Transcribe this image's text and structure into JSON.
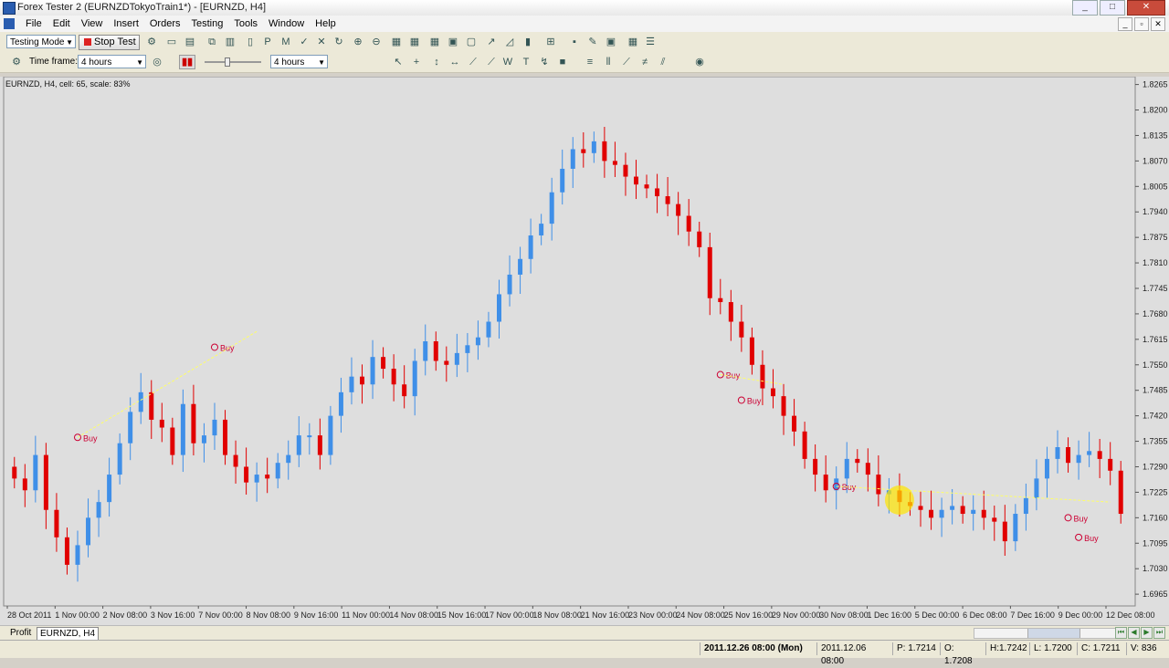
{
  "window": {
    "title": "Forex Tester 2  (EURNZDTokyoTrain1*) - [EURNZD, H4]",
    "minimize": "_",
    "maximize": "□",
    "close": "✕"
  },
  "menu": {
    "items": [
      "File",
      "Edit",
      "View",
      "Insert",
      "Orders",
      "Testing",
      "Tools",
      "Window",
      "Help"
    ],
    "mdi": [
      "_",
      "▫",
      "✕"
    ]
  },
  "toolbar1": {
    "mode_select": "Testing Mode",
    "stop_test_label": "Stop Test",
    "icons": [
      "settings-icon",
      "folder-icon",
      "open-icon",
      "copy-icon",
      "bars-icon",
      "new-doc-icon",
      "p-icon",
      "m-icon",
      "check-icon",
      "x-icon",
      "refresh-icon",
      "zoom-in-icon",
      "zoom-out-icon",
      "grid1-icon",
      "grid2-icon",
      "grid3-icon",
      "window-icon",
      "window2-icon",
      "line-chart-icon",
      "area-chart-icon",
      "candle-chart-icon",
      "plus-indicator-icon",
      "box-icon",
      "brush-icon",
      "camera-icon",
      "calc-icon",
      "list-icon"
    ]
  },
  "toolbar2": {
    "timeframe_label": "Time frame:",
    "timeframe_value": "4 hours",
    "timeframe2_value": "4 hours",
    "slider_pct": 0.4,
    "pause_glyph": "▮▮",
    "icons": [
      "cursor-icon",
      "crosshair-icon",
      "vline-icon",
      "hline-icon",
      "trendline-icon",
      "ray-icon",
      "wave-icon",
      "text-icon",
      "arrow-icon",
      "color-icon",
      "channel-icon",
      "fib-icon",
      "fan-icon",
      "gann-icon",
      "pitchfork-icon",
      "target-icon"
    ]
  },
  "chart": {
    "info": "EURNZD, H4, cell: 65, scale: 83%",
    "colors": {
      "bull": "#3f8fe8",
      "bear": "#e10000",
      "trade_line": "#ffff66",
      "marker": "#cc0033",
      "background": "#dedede"
    },
    "buy_label": "Buy"
  },
  "chart_data": {
    "type": "candlestick",
    "symbol": "EURNZD",
    "timeframe": "H4",
    "ylim": [
      1.6935,
      1.8285
    ],
    "yticks": [
      "1.8265",
      "1.8200",
      "1.8135",
      "1.8070",
      "1.8005",
      "1.7940",
      "1.7875",
      "1.7810",
      "1.7745",
      "1.7680",
      "1.7615",
      "1.7550",
      "1.7485",
      "1.7420",
      "1.7355",
      "1.7290",
      "1.7225",
      "1.7160",
      "1.7095",
      "1.7030",
      "1.6965"
    ],
    "xticks": [
      "28 Oct 2011",
      "1 Nov 00:00",
      "2 Nov 08:00",
      "3 Nov 16:00",
      "7 Nov 00:00",
      "8 Nov 08:00",
      "9 Nov 16:00",
      "11 Nov 00:00",
      "14 Nov 08:00",
      "15 Nov 16:00",
      "17 Nov 00:00",
      "18 Nov 08:00",
      "21 Nov 16:00",
      "23 Nov 00:00",
      "24 Nov 08:00",
      "25 Nov 16:00",
      "29 Nov 00:00",
      "30 Nov 08:00",
      "1 Dec 16:00",
      "5 Dec 00:00",
      "6 Dec 08:00",
      "7 Dec 16:00",
      "9 Dec 00:00",
      "12 Dec 08:00"
    ],
    "approx_closes": [
      1.726,
      1.723,
      1.732,
      1.718,
      1.711,
      1.704,
      1.709,
      1.716,
      1.72,
      1.727,
      1.735,
      1.743,
      1.748,
      1.741,
      1.739,
      1.732,
      1.745,
      1.735,
      1.737,
      1.741,
      1.732,
      1.729,
      1.725,
      1.727,
      1.726,
      1.73,
      1.732,
      1.737,
      1.737,
      1.732,
      1.742,
      1.748,
      1.752,
      1.75,
      1.757,
      1.754,
      1.75,
      1.747,
      1.756,
      1.761,
      1.756,
      1.755,
      1.758,
      1.76,
      1.762,
      1.766,
      1.773,
      1.778,
      1.782,
      1.788,
      1.791,
      1.799,
      1.805,
      1.81,
      1.809,
      1.812,
      1.807,
      1.806,
      1.803,
      1.801,
      1.8,
      1.798,
      1.796,
      1.793,
      1.789,
      1.785,
      1.772,
      1.771,
      1.766,
      1.762,
      1.755,
      1.749,
      1.747,
      1.742,
      1.738,
      1.731,
      1.727,
      1.723,
      1.726,
      1.731,
      1.73,
      1.727,
      1.722,
      1.723,
      1.72,
      1.719,
      1.718,
      1.716,
      1.718,
      1.719,
      1.717,
      1.718,
      1.716,
      1.715,
      1.71,
      1.717,
      1.721,
      1.726,
      1.731,
      1.734,
      1.73,
      1.732,
      1.733,
      1.731,
      1.728,
      1.717
    ],
    "trades": [
      {
        "label": "Buy",
        "x_index": 6,
        "price": 1.7365
      },
      {
        "label": "Buy",
        "x_index": 19,
        "price": 1.7595
      },
      {
        "label": "Buy",
        "x_index": 67,
        "price": 1.7525
      },
      {
        "label": "Buy",
        "x_index": 69,
        "price": 1.746
      },
      {
        "label": "Buy",
        "x_index": 78,
        "price": 1.724
      },
      {
        "label": "Buy",
        "x_index": 100,
        "price": 1.716
      },
      {
        "label": "Buy",
        "x_index": 101,
        "price": 1.711
      }
    ],
    "title": "",
    "xlabel": "",
    "ylabel": "",
    "grid": false,
    "legend": "none"
  },
  "tabs": {
    "profit": "Profit",
    "symbol": "EURNZD, H4"
  },
  "status": {
    "datetime": "2011.12.26 08:00 (Mon)",
    "bar_time": "2011.12.06 08:00",
    "price": "P: 1.7214",
    "open": "O: 1.7208",
    "high": "H:1.7242",
    "low": "L: 1.7200",
    "close": "C: 1.7211",
    "volume": "V: 836"
  }
}
